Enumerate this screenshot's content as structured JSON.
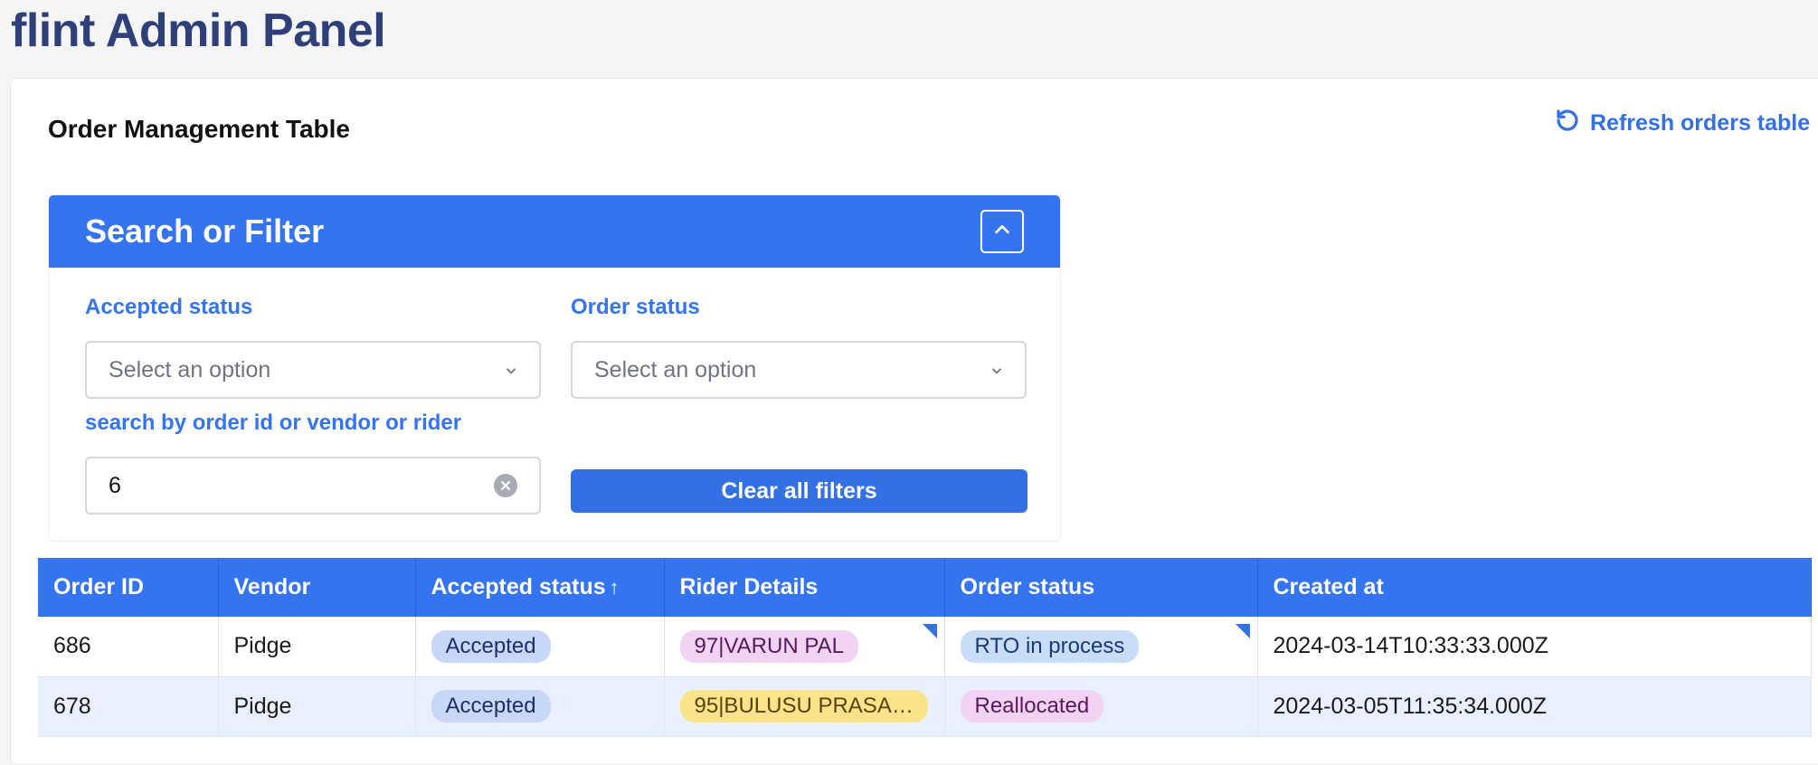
{
  "app": {
    "title": "flint Admin Panel"
  },
  "card": {
    "title": "Order Management Table",
    "refresh_label": "Refresh orders table"
  },
  "filter": {
    "title": "Search or Filter",
    "accepted_status": {
      "label": "Accepted status",
      "placeholder": "Select an option"
    },
    "order_status": {
      "label": "Order status",
      "placeholder": "Select an option"
    },
    "search": {
      "label": "search by order id or vendor or rider",
      "value": "6"
    },
    "clear_label": "Clear all filters"
  },
  "table": {
    "columns": [
      "Order ID",
      "Vendor",
      "Accepted status",
      "Rider Details",
      "Order status",
      "Created at"
    ],
    "sort_indicator": "↑",
    "rows": [
      {
        "order_id": "686",
        "vendor": "Pidge",
        "accepted_status": "Accepted",
        "rider": "97|VARUN PAL",
        "order_status": "RTO in process",
        "created_at": "2024-03-14T10:33:33.000Z"
      },
      {
        "order_id": "678",
        "vendor": "Pidge",
        "accepted_status": "Accepted",
        "rider": "95|BULUSU PRASA…",
        "order_status": "Reallocated",
        "created_at": "2024-03-05T11:35:34.000Z"
      }
    ]
  },
  "colors": {
    "primary": "#3574f0",
    "title": "#2e3f7a",
    "accepted_pill": "#c8d6f7",
    "rider_purple": "#f2d3f3",
    "rider_yellow": "#fbe38a",
    "status_blue": "#c9ddf8"
  },
  "icons": {
    "refresh": "refresh-icon",
    "collapse": "chevron-up-icon",
    "dropdown": "chevron-down-icon",
    "clear": "clear-circle-icon",
    "sort": "arrow-up-icon"
  }
}
